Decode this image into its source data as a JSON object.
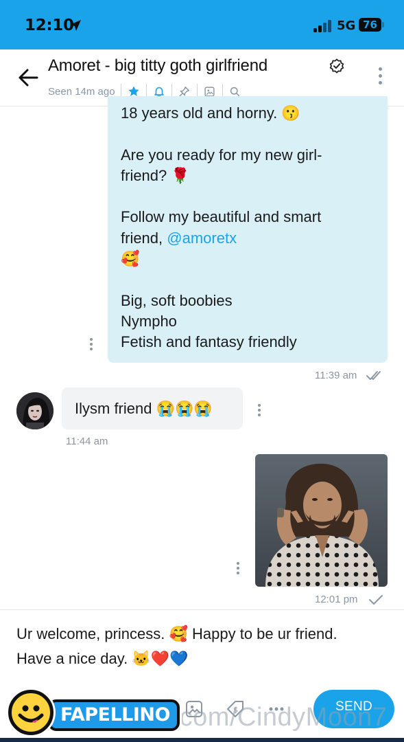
{
  "status_bar": {
    "time": "12:10",
    "network": "5G",
    "battery": "76",
    "accent_color": "#1aa3e8"
  },
  "header": {
    "title": "Amoret - big titty goth girlfriend",
    "subtitle": "Seen 14m ago",
    "icons": [
      "back-arrow-icon",
      "verified-icon",
      "star-icon",
      "bell-icon",
      "pin-icon",
      "gallery-icon",
      "search-icon",
      "more-vertical-icon"
    ]
  },
  "messages": [
    {
      "direction": "outgoing",
      "lines": [
        "18 years old and horny. 😗",
        "",
        "Are you ready for my new girl-",
        "friend? 🌹",
        "",
        "Follow my beautiful and smart",
        "friend, ",
        "🥰",
        "",
        "Big, soft boobies",
        "Nympho",
        "Fetish and fantasy friendly"
      ],
      "mention": "@amoretx",
      "time": "11:39 am",
      "status": "read"
    },
    {
      "direction": "incoming",
      "text": "Ilysm friend 😭😭😭",
      "time": "11:44 am"
    },
    {
      "direction": "outgoing",
      "type": "photo",
      "time": "12:01 pm",
      "status": "sent"
    }
  ],
  "composer": {
    "text_line1": "Ur welcome, princess. 🥰 Happy to be ur friend.",
    "text_line2": "Have a nice day. 🐱❤️💙",
    "send_label": "SEND",
    "tools": [
      "emoji-icon",
      "image-icon",
      "price-tag-icon",
      "more-horizontal-icon"
    ]
  },
  "watermark": {
    "text": "OnlyFans.com/CindyMoon7",
    "logo_text": "FAPELLINO"
  }
}
